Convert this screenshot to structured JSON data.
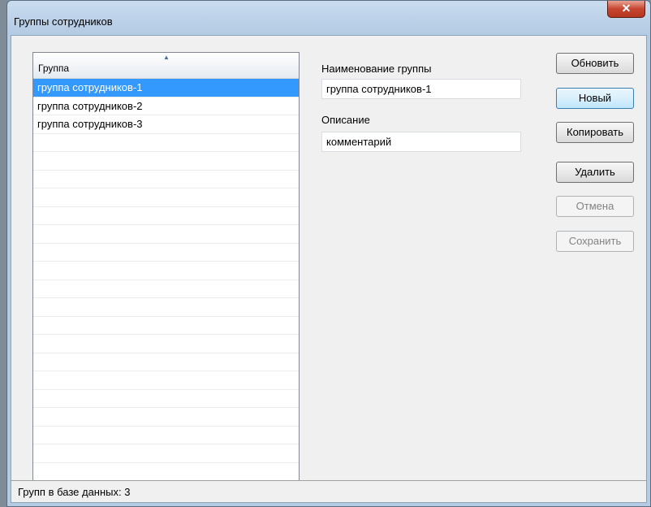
{
  "window": {
    "title": "Группы сотрудников",
    "close_glyph": "✕"
  },
  "list": {
    "header": "Группа",
    "sort_glyph": "▲",
    "items": [
      {
        "label": "группа сотрудников-1",
        "selected": true
      },
      {
        "label": "группа сотрудников-2",
        "selected": false
      },
      {
        "label": "группа сотрудников-3",
        "selected": false
      },
      {
        "label": "",
        "selected": false
      },
      {
        "label": "",
        "selected": false
      },
      {
        "label": "",
        "selected": false
      },
      {
        "label": "",
        "selected": false
      },
      {
        "label": "",
        "selected": false
      },
      {
        "label": "",
        "selected": false
      },
      {
        "label": "",
        "selected": false
      },
      {
        "label": "",
        "selected": false
      },
      {
        "label": "",
        "selected": false
      },
      {
        "label": "",
        "selected": false
      },
      {
        "label": "",
        "selected": false
      },
      {
        "label": "",
        "selected": false
      },
      {
        "label": "",
        "selected": false
      },
      {
        "label": "",
        "selected": false
      },
      {
        "label": "",
        "selected": false
      },
      {
        "label": "",
        "selected": false
      },
      {
        "label": "",
        "selected": false
      },
      {
        "label": "",
        "selected": false
      },
      {
        "label": "",
        "selected": false
      }
    ]
  },
  "form": {
    "name_label": "Наименование группы",
    "name_value": "группа сотрудников-1",
    "desc_label": "Описание",
    "desc_value": "комментарий"
  },
  "buttons": {
    "refresh": "Обновить",
    "new": "Новый",
    "copy": "Копировать",
    "delete": "Удалить",
    "cancel": "Отмена",
    "save": "Сохранить"
  },
  "status": {
    "text": "Групп в базе данных: 3"
  }
}
